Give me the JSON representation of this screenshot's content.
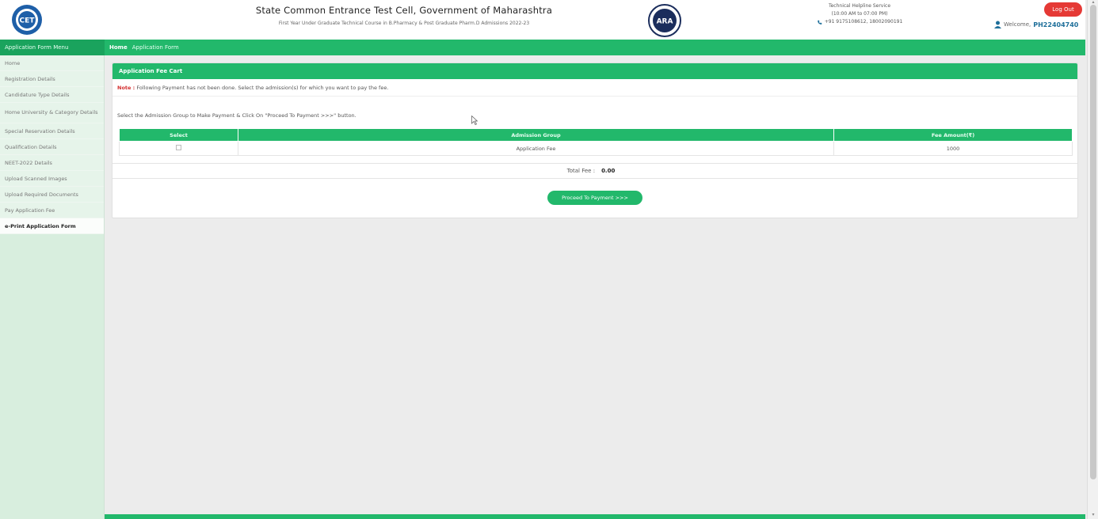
{
  "header": {
    "title": "State Common Entrance Test Cell, Government of Maharashtra",
    "subtitle": "First Year Under Graduate Technical Course in B.Pharmacy & Post Graduate Pharm.D Admissions 2022-23",
    "logo_left_text": "CET",
    "logo_mid_text": "ARA",
    "helpline_title": "Technical Helpline Service",
    "helpline_hours": "(10:00 AM to 07:00 PM)",
    "helpline_phone": "+91 9175108612, 18002090191",
    "logout_label": "Log Out",
    "welcome_label": "Welcome,",
    "user_id": "PH22404740"
  },
  "nav": {
    "menu_title": "Application Form Menu",
    "home": "Home",
    "crumb": "Application Form"
  },
  "sidebar": {
    "items": [
      {
        "label": "Home"
      },
      {
        "label": "Registration Details"
      },
      {
        "label": "Candidature Type Details"
      },
      {
        "label": "Home University & Category Details"
      },
      {
        "label": "Special Reservation Details"
      },
      {
        "label": "Qualification Details"
      },
      {
        "label": "NEET-2022 Details"
      },
      {
        "label": "Upload Scanned Images"
      },
      {
        "label": "Upload Required Documents"
      },
      {
        "label": "Pay Application Fee"
      },
      {
        "label": "e-Print Application Form"
      }
    ]
  },
  "panel": {
    "title": "Application Fee Cart",
    "note_label": "Note :",
    "note_text": "Following Payment has not been done. Select the admission(s) for which you want to pay the fee.",
    "instruction": "Select the Admission Group to Make Payment & Click On \"Proceed To Payment >>>\" button.",
    "table": {
      "headers": [
        "Select",
        "Admission Group",
        "Fee Amount(₹)"
      ],
      "rows": [
        {
          "group": "Application Fee",
          "amount": "1000"
        }
      ]
    },
    "total_label": "Total Fee :",
    "total_value": "0.00",
    "proceed_label": "Proceed To Payment >>>"
  }
}
